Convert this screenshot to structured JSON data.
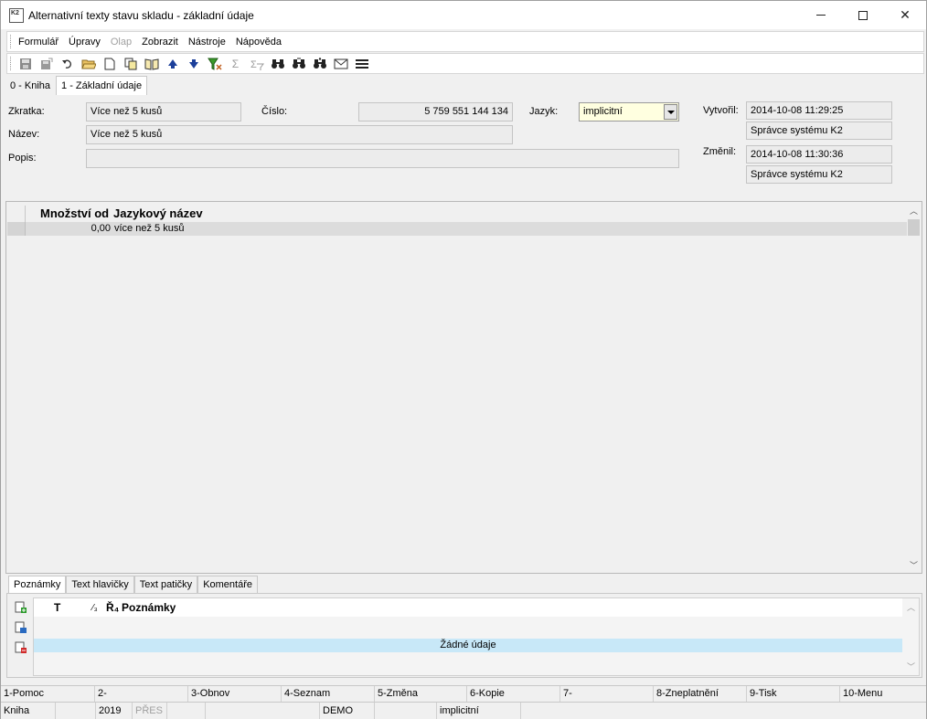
{
  "window": {
    "title": "Alternativní texty stavu skladu - základní údaje"
  },
  "menu": [
    "Formulář",
    "Úpravy",
    "Olap",
    "Zobrazit",
    "Nástroje",
    "Nápověda"
  ],
  "menu_disabled": [
    "Olap"
  ],
  "toolbar_icons": [
    "save-icon",
    "save-all-icon",
    "undo-icon",
    "open-folder-icon",
    "new-document-icon",
    "copy-icon",
    "book-icon",
    "arrow-up-icon",
    "arrow-down-icon",
    "filter-icon",
    "sum-icon",
    "sum-filter-icon",
    "binoculars-icon",
    "binoculars-next-icon",
    "binoculars-all-icon",
    "mail-icon",
    "menu-lines-icon"
  ],
  "tabs_top": [
    {
      "label": "0 - Kniha",
      "active": false
    },
    {
      "label": "1 - Základní údaje",
      "active": true
    }
  ],
  "form": {
    "zkratka_label": "Zkratka:",
    "zkratka_value": "Více než 5 kusů",
    "cislo_label": "Číslo:",
    "cislo_value": "5 759 551 144 134",
    "jazyk_label": "Jazyk:",
    "jazyk_value": "implicitní",
    "vytvoril_label": "Vytvořil:",
    "vytvoril_date": "2014-10-08 11:29:25",
    "vytvoril_user": "Správce systému K2",
    "nazev_label": "Název:",
    "nazev_value": "Více než 5 kusů",
    "popis_label": "Popis:",
    "popis_value": "",
    "zmenil_label": "Změnil:",
    "zmenil_date": "2014-10-08 11:30:36",
    "zmenil_user": "Správce systému K2"
  },
  "grid": {
    "columns": [
      "Množství od",
      "Jazykový název"
    ],
    "rows": [
      {
        "mnozstvi": "0,00",
        "nazev": "více než 5 kusů"
      }
    ]
  },
  "bottom_tabs": [
    {
      "label": "Poznámky",
      "active": true
    },
    {
      "label": "Text hlavičky",
      "active": false
    },
    {
      "label": "Text patičky",
      "active": false
    },
    {
      "label": "Komentáře",
      "active": false
    }
  ],
  "notes": {
    "col_t": "T",
    "col_sort": "⁄₃",
    "col_r": "Ř₄",
    "col_poznamky": "Poznámky",
    "empty": "Žádné údaje"
  },
  "fkeys": [
    "1-Pomoc",
    "2-",
    "3-Obnov",
    "4-Seznam",
    "5-Změna",
    "6-Kopie",
    "7-",
    "8-Zneplatnění",
    "9-Tisk",
    "10-Menu"
  ],
  "status": {
    "s1": "Kniha",
    "s2": "",
    "s3": "2019",
    "s4": "PŘES",
    "s5": "",
    "s6": "",
    "s7": "DEMO",
    "s8": "",
    "s9": "implicitní",
    "s10": ""
  }
}
